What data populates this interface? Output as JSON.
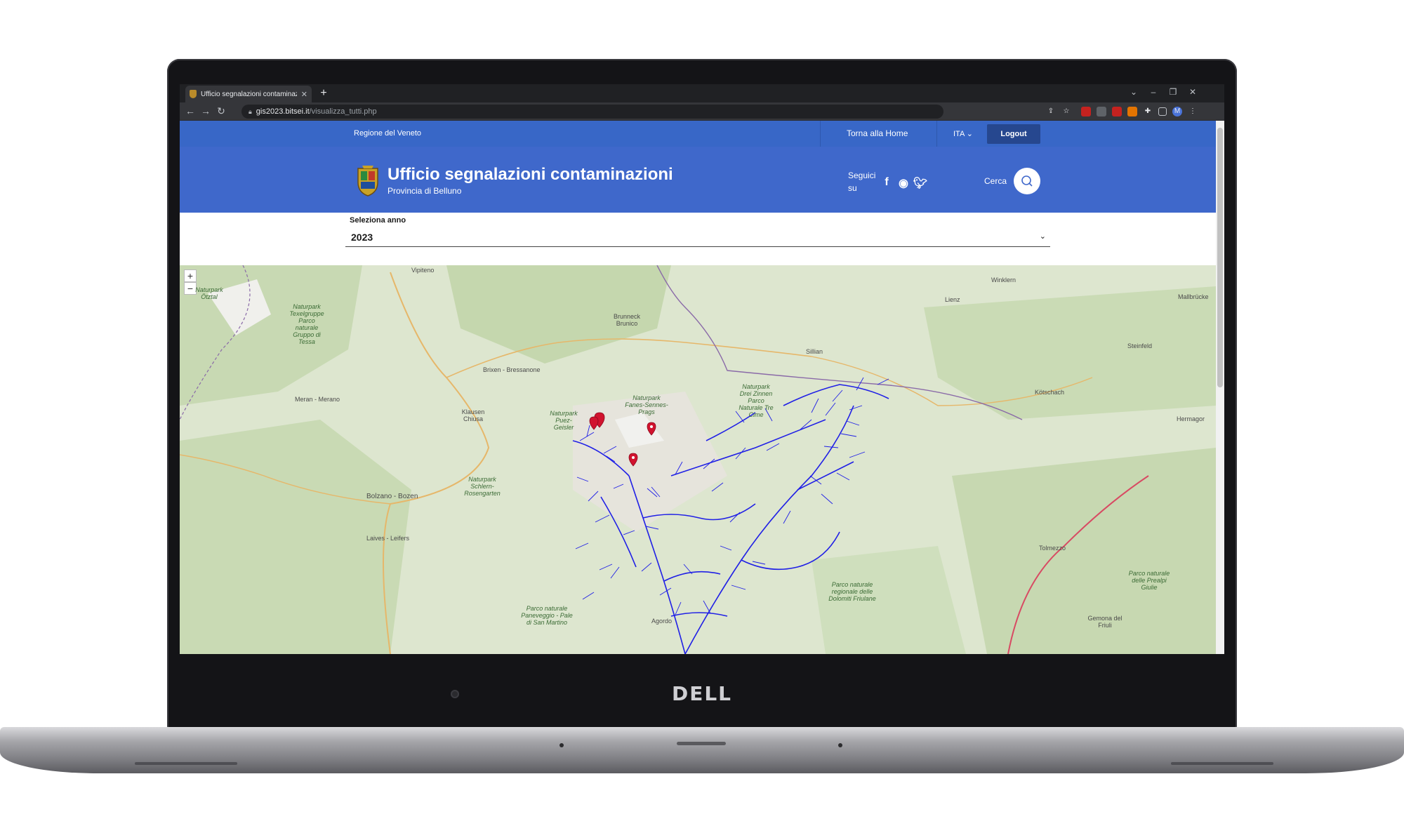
{
  "browser": {
    "tab_title": "Ufficio segnalazioni contaminazioni",
    "tab_close": "✕",
    "new_tab": "+",
    "url_host": "gis2023.bitsei.it",
    "url_path": "/visualizza_tutti.php",
    "profile_initial": "M"
  },
  "topbar": {
    "region_link": "Regione del Veneto",
    "home_link": "Torna alla Home",
    "language": "ITA",
    "logout": "Logout"
  },
  "header": {
    "title": "Ufficio segnalazioni contaminazioni",
    "subtitle": "Provincia di Belluno",
    "follow_label": "Seguici su",
    "search_label": "Cerca",
    "social": [
      "facebook-icon",
      "github-icon",
      "twitter-icon"
    ]
  },
  "filter": {
    "label": "Seleziona anno",
    "selected_year": "2023"
  },
  "map": {
    "zoom_in": "+",
    "zoom_out": "−",
    "places": [
      {
        "name": "Vipiteno"
      },
      {
        "name": "Winklern"
      },
      {
        "name": "Lienz"
      },
      {
        "name": "Mallbrücke"
      },
      {
        "name": "Brunneck Brunico"
      },
      {
        "name": "Sillian"
      },
      {
        "name": "Steinfeld"
      },
      {
        "name": "Brixen - Bressanone"
      },
      {
        "name": "Meran - Merano"
      },
      {
        "name": "Kötschach"
      },
      {
        "name": "Klausen Chiusa"
      },
      {
        "name": "Hermagor"
      },
      {
        "name": "Bolzano - Bozen"
      },
      {
        "name": "Laives - Leifers"
      },
      {
        "name": "Tolmezzo"
      },
      {
        "name": "Agordo"
      },
      {
        "name": "Gemona del Friuli"
      }
    ],
    "parks": [
      {
        "name": "Naturpark Ötztal"
      },
      {
        "name": "Naturpark Texelgruppe Parco naturale Gruppo di Tessa"
      },
      {
        "name": "Naturpark Fanes-Sennes-Prags"
      },
      {
        "name": "Naturpark Puez-Geisler"
      },
      {
        "name": "Naturpark Drei Zinnen Parco Naturale Tre Cime"
      },
      {
        "name": "Naturpark Schlern-Rosengarten"
      },
      {
        "name": "Parco naturale regionale delle Dolomiti Friulane"
      },
      {
        "name": "Parco naturale Paneveggio - Pale di San Martino"
      },
      {
        "name": "Parco naturale delle Prealpi Giulie"
      }
    ],
    "colors": {
      "rivers": "#1f1fe6",
      "markers": "#d1132e",
      "base": "#d9e3c8"
    },
    "markers_count": 4
  },
  "device": {
    "brand": "DELL"
  }
}
